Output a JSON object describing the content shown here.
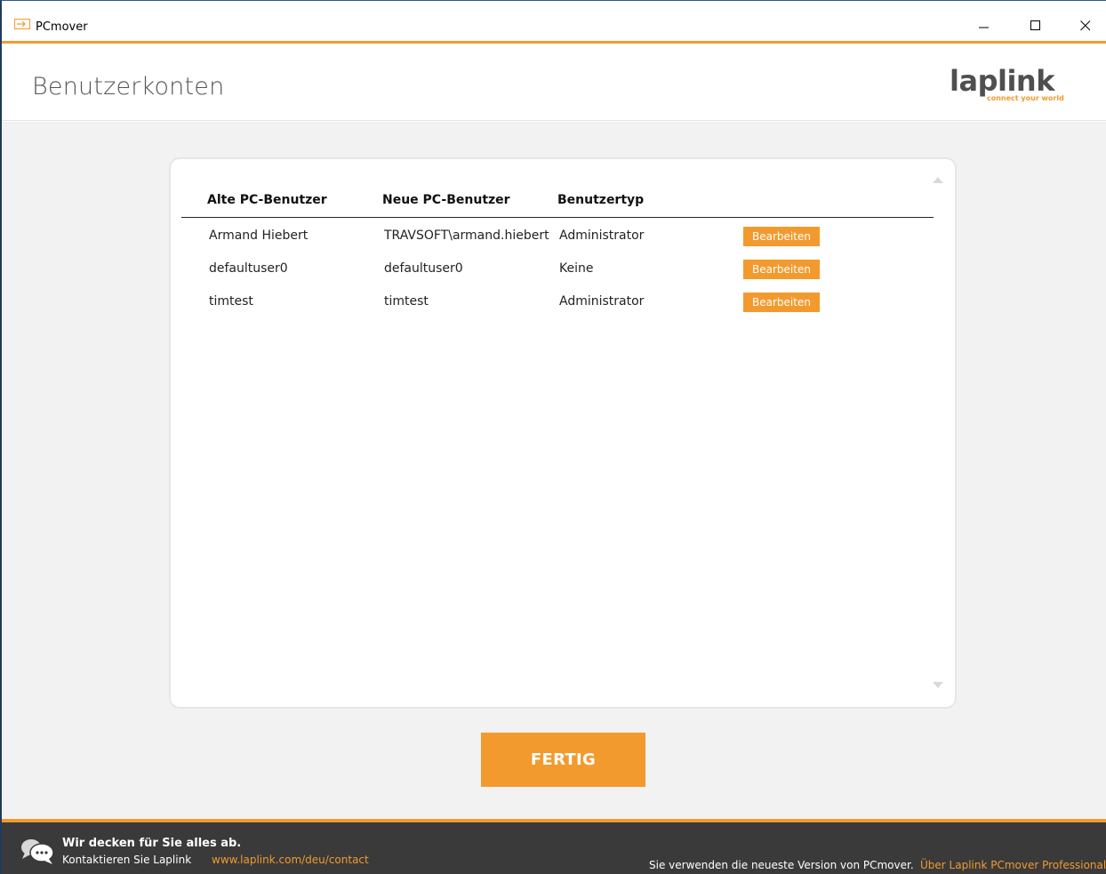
{
  "window": {
    "title": "PCmover",
    "icon": "arrow-into-box-icon",
    "controls": [
      "minimize-icon",
      "maximize-icon",
      "close-icon"
    ]
  },
  "header": {
    "title": "Benutzerkonten",
    "logo_text": "laplink",
    "logo_tagline": "connect your world"
  },
  "table": {
    "columns": [
      "Alte PC-Benutzer",
      "Neue PC-Benutzer",
      "Benutzertyp"
    ],
    "rows": [
      {
        "old_user": "Armand Hiebert",
        "new_user": "TRAVSOFT\\armand.hiebert",
        "type": "Administrator",
        "action": "Bearbeiten"
      },
      {
        "old_user": "defaultuser0",
        "new_user": "defaultuser0",
        "type": "Keine",
        "action": "Bearbeiten"
      },
      {
        "old_user": "timtest",
        "new_user": "timtest",
        "type": "Administrator",
        "action": "Bearbeiten"
      }
    ]
  },
  "done_button": "FERTIG",
  "footer": {
    "tagline": "Wir decken für Sie alles ab.",
    "contact_label": "Kontaktieren Sie Laplink",
    "contact_link": "www.laplink.com/deu/contact",
    "version_text": "Sie verwenden die neueste Version von PCmover.",
    "about_link": "Über Laplink PCmover Professional"
  },
  "colors": {
    "accent": "#f39a2e",
    "footer_bg": "#3a3a3a",
    "content_bg": "#f2f2f2"
  }
}
